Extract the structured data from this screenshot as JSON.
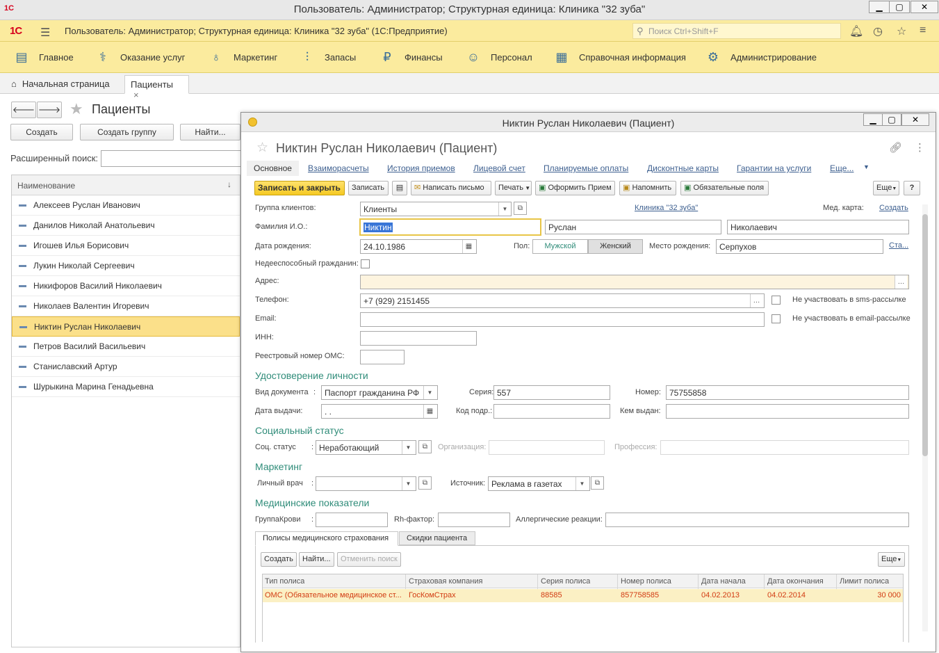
{
  "window": {
    "title": "Пользователь: Администратор;  Структурная единица: Клиника \"32 зуба\"",
    "logo": "1C"
  },
  "appbar": {
    "brand": "1С",
    "title": "Пользователь: Администратор;  Структурная единица: Клиника \"32 зуба\"  (1С:Предприятие)",
    "search_placeholder": "Поиск Ctrl+Shift+F"
  },
  "sections": [
    "Главное",
    "Оказание услуг",
    "Маркетинг",
    "Запасы",
    "Финансы",
    "Персонал",
    "Справочная информация",
    "Администрирование"
  ],
  "tabs": {
    "home": "Начальная страница",
    "patients": "Пациенты",
    "close": "×"
  },
  "list_form": {
    "title": "Пациенты",
    "create": "Создать",
    "create_group": "Создать группу",
    "find": "Найти...",
    "adv_search_label": "Расширенный поиск:",
    "column_header": "Наименование",
    "sort_arrow": "↓",
    "rows": [
      "Алексеев Руслан Иванович",
      "Данилов Николай Анатольевич",
      "Игошев Илья Борисович",
      "Лукин Николай Сергеевич",
      "Никифоров Василий Николаевич",
      "Николаев Валентин Игоревич",
      "Никтин Руслан Николаевич",
      "Петров Василий Васильевич",
      "Станиславский Артур",
      "Шурыкина Марина Генадьевна"
    ],
    "selected_index": 6
  },
  "modal": {
    "title": "Никтин Руслан Николаевич (Пациент)",
    "header": "Никтин Руслан Николаевич (Пациент)",
    "nav": [
      "Основное",
      "Взаиморасчеты",
      "История приемов",
      "Лицевой счет",
      "Планируемые оплаты",
      "Дисконтные карты",
      "Гарантии на услуги",
      "Еще..."
    ],
    "toolbar": {
      "save_close": "Записать и закрыть",
      "save": "Записать",
      "write_letter": "Написать письмо",
      "print": "Печать",
      "make_visit": "Оформить Прием",
      "remind": "Напомнить",
      "required": "Обязательные поля",
      "more": "Еще",
      "help": "?"
    },
    "fields": {
      "client_group_label": "Группа клиентов:",
      "client_group": "Клиенты",
      "clinic_link": "Клиника \"32 зуба\"",
      "med_card_label": "Мед. карта:",
      "med_card_link": "Создать",
      "fio_label": "Фамилия И.О.:",
      "last_name": "Никтин",
      "first_name": "Руслан",
      "middle_name": "Николаевич",
      "birth_label": "Дата рождения:",
      "birth_date": "24.10.1986",
      "sex_label": "Пол:",
      "male": "Мужской",
      "female": "Женский",
      "birth_place_label": "Место рождения:",
      "birth_place": "Серпухов",
      "birth_place_link": "Ста...",
      "incapable_label": "Недееспособный гражданин:",
      "address_label": "Адрес:",
      "phone_label": "Телефон:",
      "phone": "+7 (929) 2151455",
      "no_sms": "Не участвовать в sms-рассылке",
      "email_label": "Email:",
      "no_email": "Не участвовать в email-рассылке",
      "inn_label": "ИНН:",
      "oms_reg_label": "Реестровый номер ОМС:"
    },
    "identity": {
      "heading": "Удостоверение личности",
      "doc_type_label": "Вид документа",
      "doc_type": "Паспорт гражданина РФ",
      "series_label": "Серия:",
      "series": "557",
      "number_label": "Номер:",
      "number": "75755858",
      "issue_date_label": "Дата выдачи:",
      "issue_date": " .  .",
      "dept_code_label": "Код подр.:",
      "issued_by_label": "Кем выдан:"
    },
    "social": {
      "heading": "Социальный статус",
      "status_label": "Соц. статус",
      "status": "Неработающий",
      "org_label": "Организация:",
      "prof_label": "Профессия:"
    },
    "marketing": {
      "heading": "Маркетинг",
      "doctor_label": "Личный врач",
      "source_label": "Источник:",
      "source": "Реклама в газетах"
    },
    "medical": {
      "heading": "Медицинские показатели",
      "blood_label": "ГруппаКрови",
      "rh_label": "Rh-фактор:",
      "allergy_label": "Аллергические реакции:"
    },
    "subtabs": [
      "Полисы медицинского страхования",
      "Скидки пациента"
    ],
    "policies": {
      "create": "Создать",
      "find": "Найти...",
      "cancel_search": "Отменить поиск",
      "more": "Еще",
      "columns": [
        "Тип полиса",
        "Страховая компания",
        "Серия полиса",
        "Номер полиса",
        "Дата начала",
        "Дата окончания",
        "Лимит полиса"
      ],
      "rows": [
        [
          "ОМС (Обязательное медицинское ст...",
          "ГосКомСтрах",
          "88585",
          "857758585",
          "04.02.2013",
          "04.02.2014",
          "30 000"
        ]
      ]
    }
  }
}
